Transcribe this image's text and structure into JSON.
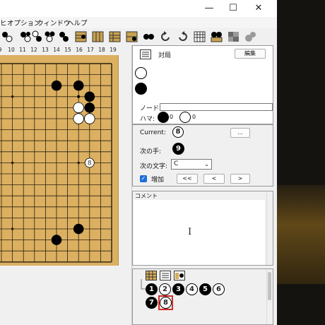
{
  "window": {
    "controls": {
      "minimize": "—",
      "maximize": "☐",
      "close": "✕"
    }
  },
  "menu": {
    "items": [
      {
        "label": "ヒ"
      },
      {
        "label": "オプション"
      },
      {
        "label": "ウィンドウ"
      },
      {
        "label": "ヘルプ"
      }
    ]
  },
  "board": {
    "columns": [
      "9",
      "10",
      "11",
      "12",
      "13",
      "14",
      "15",
      "16",
      "17",
      "18",
      "19"
    ],
    "stones": [
      {
        "col": 14,
        "row": 3,
        "color": "black",
        "label": ""
      },
      {
        "col": 16,
        "row": 3,
        "color": "black",
        "label": ""
      },
      {
        "col": 17,
        "row": 4,
        "color": "black",
        "label": ""
      },
      {
        "col": 16,
        "row": 5,
        "color": "white",
        "label": ""
      },
      {
        "col": 17,
        "row": 5,
        "color": "black",
        "label": ""
      },
      {
        "col": 16,
        "row": 6,
        "color": "white",
        "label": ""
      },
      {
        "col": 17,
        "row": 6,
        "color": "white",
        "label": ""
      },
      {
        "col": 17,
        "row": 10,
        "color": "white",
        "label": "8"
      },
      {
        "col": 16,
        "row": 16,
        "color": "black",
        "label": ""
      },
      {
        "col": 14,
        "row": 17,
        "color": "black",
        "label": ""
      }
    ],
    "marks": [
      {
        "col": 16,
        "row": 4
      }
    ]
  },
  "game_panel": {
    "title": "対局",
    "edit_button": "編集"
  },
  "node_panel": {
    "node_label": "ノード:",
    "captures_label": "ハマ:",
    "black_captures": "0",
    "white_captures": "0",
    "current_label": "Current:",
    "current_move": "8",
    "current_button": "...",
    "next_move_label": "次の手:",
    "next_move": "9",
    "next_letter_label": "次の文字:",
    "next_letter": "C",
    "add_label": "増加",
    "nav_first": "<<",
    "nav_prev": "<",
    "nav_next": ">"
  },
  "comment_panel": {
    "title": "コメント"
  },
  "tree": {
    "moves": [
      {
        "number": "1",
        "color": "black"
      },
      {
        "number": "2",
        "color": "white"
      },
      {
        "number": "3",
        "color": "black"
      },
      {
        "number": "4",
        "color": "white"
      },
      {
        "number": "5",
        "color": "black"
      },
      {
        "number": "6",
        "color": "white"
      },
      {
        "number": "7",
        "color": "black"
      },
      {
        "number": "8",
        "color": "white",
        "current": true
      }
    ]
  },
  "colors": {
    "board": "#dbb061",
    "highlight": "#d62b2b",
    "accent": "#1f6fd6"
  }
}
